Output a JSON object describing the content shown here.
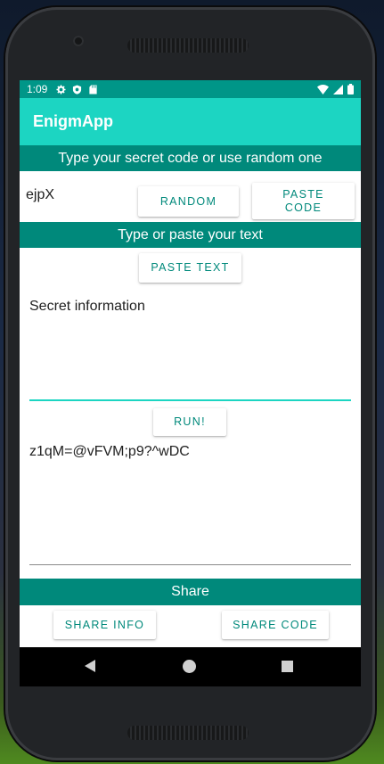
{
  "status_bar": {
    "time": "1:09",
    "left_icons": [
      "gear-icon",
      "shield-icon",
      "sd-card-icon"
    ],
    "right_icons": [
      "wifi-icon",
      "signal-icon",
      "battery-icon"
    ]
  },
  "app_bar": {
    "title": "EnigmApp"
  },
  "code_section": {
    "header": "Type your secret code or use random one",
    "code_value": "ejpX",
    "random_label": "RANDOM",
    "paste_code_label": "PASTE\nCODE"
  },
  "text_section": {
    "header": "Type or paste your text",
    "paste_text_label": "PASTE TEXT",
    "input_value": "Secret information",
    "run_label": "RUN!",
    "output_value": "z1qM=@vFVM;p9?^wDC"
  },
  "share_section": {
    "header": "Share",
    "share_info_label": "SHARE INFO",
    "share_code_label": "SHARE CODE"
  },
  "nav_bar": {
    "icons": [
      "back-icon",
      "home-icon",
      "recents-icon"
    ]
  },
  "colors": {
    "primary": "#1cd5c2",
    "primary_dark": "#009688",
    "section": "#00897b",
    "accent_text": "#00897b"
  }
}
